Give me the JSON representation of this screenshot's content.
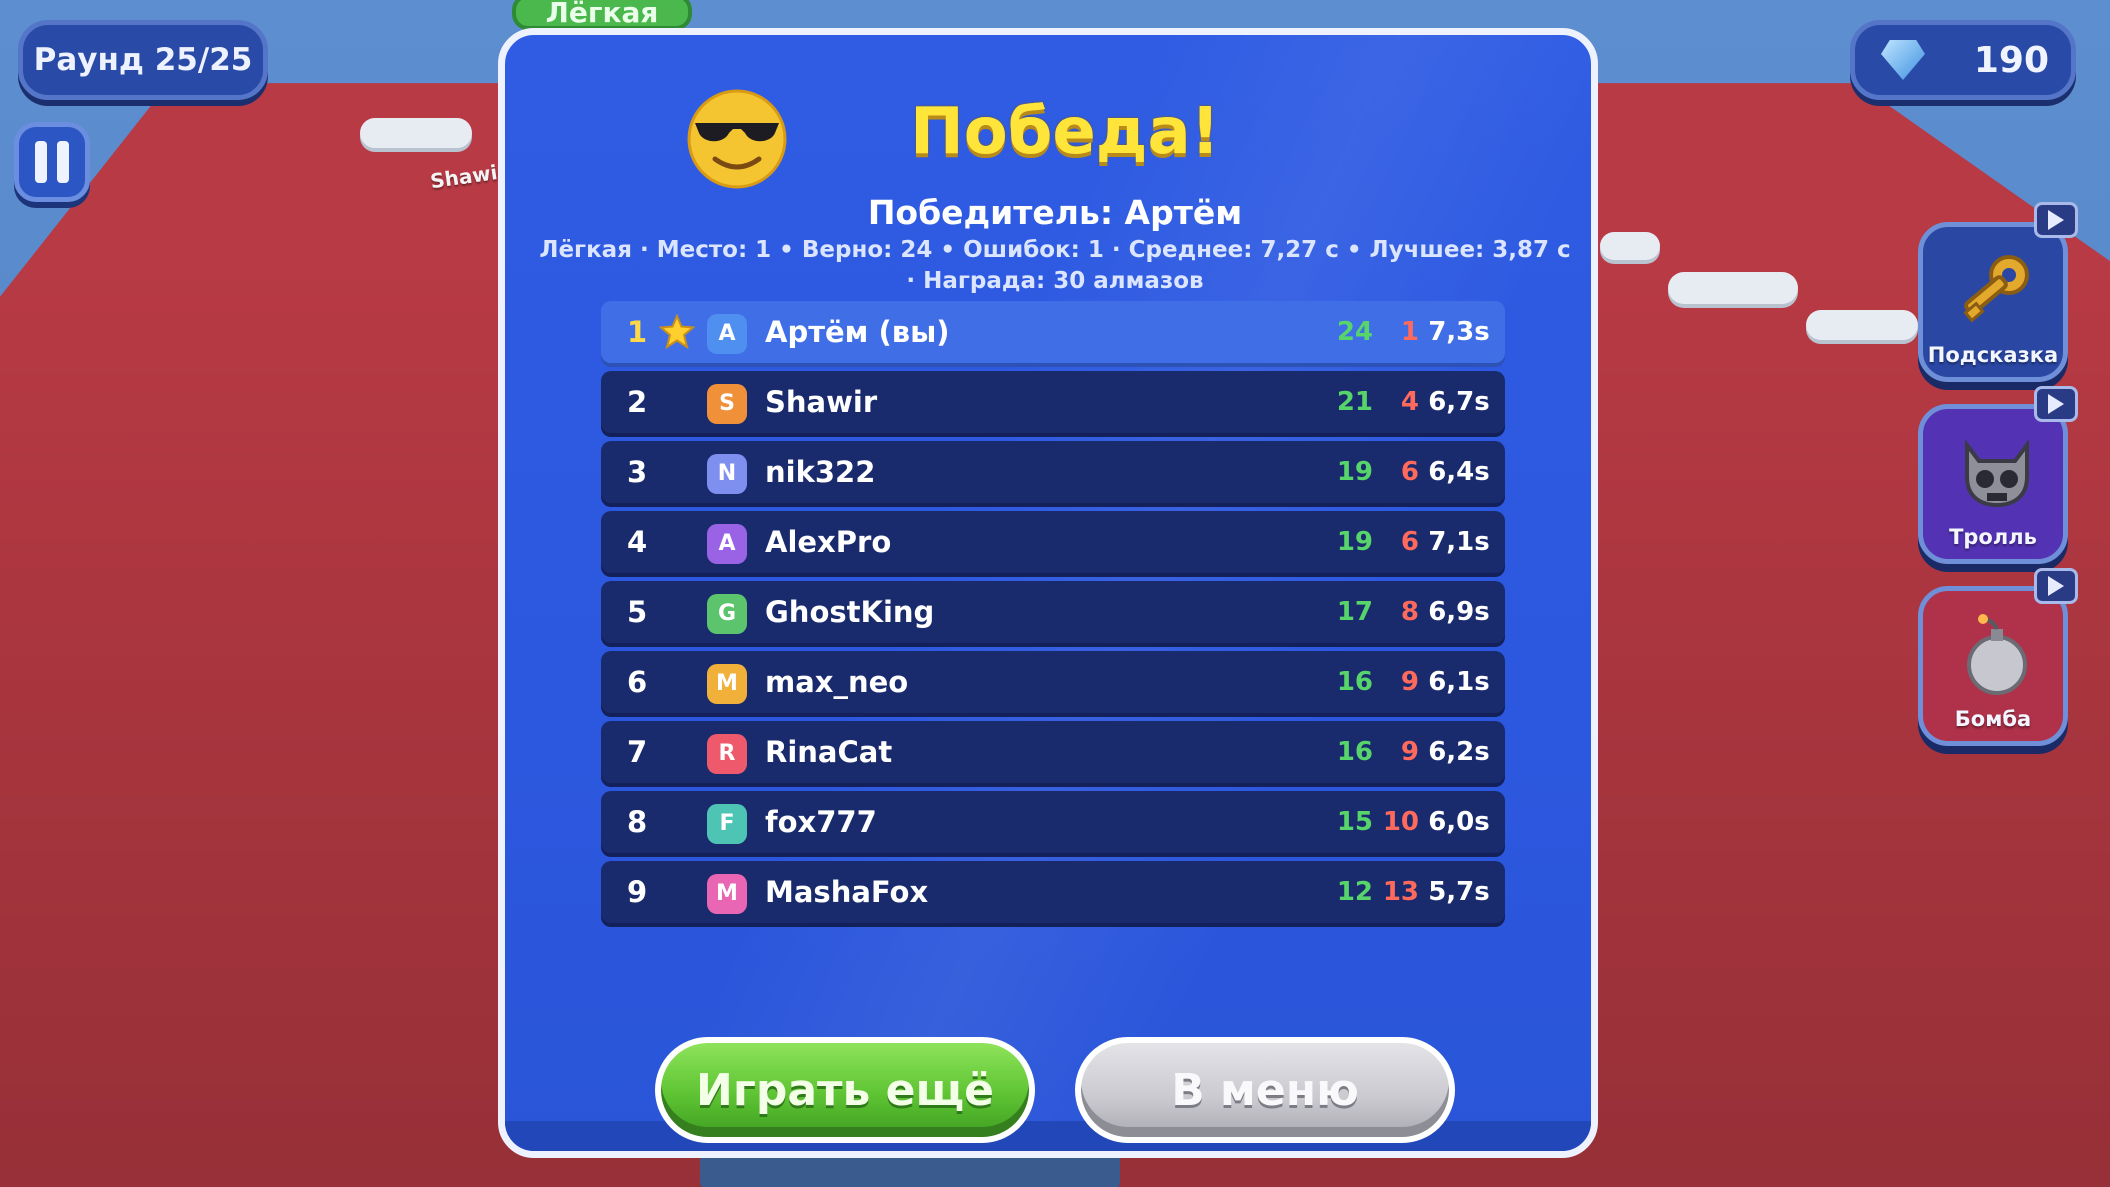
{
  "hud": {
    "round": "Раунд 25/25",
    "difficulty_tag": "Лёгкая",
    "gems": "190",
    "bg_player_name": "Shawir"
  },
  "powerups": [
    {
      "label": "Подсказка",
      "icon": "key-icon",
      "color": "#2a47a4"
    },
    {
      "label": "Тролль",
      "icon": "troll-skull-icon",
      "color": "#5432b4"
    },
    {
      "label": "Бомба",
      "icon": "bomb-icon",
      "color": "#b0314a"
    }
  ],
  "modal": {
    "title": "Победа!",
    "winner": "Победитель: Артём",
    "stats_line1": "Лёгкая · Место: 1 • Верно: 24 • Ошибок: 1 · Среднее: 7,27 с • Лучшее: 3,87 с",
    "stats_line2": "· Награда: 30 алмазов",
    "play_again": "Играть ещё",
    "menu": "В меню"
  },
  "leaderboard": [
    {
      "rank": "1",
      "avatar": "A",
      "name": "Артём (вы)",
      "correct": "24",
      "wrong": "1",
      "time": "7,3s",
      "avatar_color": "#4f8ff0",
      "me": true
    },
    {
      "rank": "2",
      "avatar": "S",
      "name": "Shawir",
      "correct": "21",
      "wrong": "4",
      "time": "6,7s",
      "avatar_color": "#f0913a"
    },
    {
      "rank": "3",
      "avatar": "N",
      "name": "nik322",
      "correct": "19",
      "wrong": "6",
      "time": "6,4s",
      "avatar_color": "#7f8ff0"
    },
    {
      "rank": "4",
      "avatar": "A",
      "name": "AlexPro",
      "correct": "19",
      "wrong": "6",
      "time": "7,1s",
      "avatar_color": "#9a63e6"
    },
    {
      "rank": "5",
      "avatar": "G",
      "name": "GhostKing",
      "correct": "17",
      "wrong": "8",
      "time": "6,9s",
      "avatar_color": "#5cc46c"
    },
    {
      "rank": "6",
      "avatar": "M",
      "name": "max_neo",
      "correct": "16",
      "wrong": "9",
      "time": "6,1s",
      "avatar_color": "#f0b03a"
    },
    {
      "rank": "7",
      "avatar": "R",
      "name": "RinaCat",
      "correct": "16",
      "wrong": "9",
      "time": "6,2s",
      "avatar_color": "#ee5a6c"
    },
    {
      "rank": "8",
      "avatar": "F",
      "name": "fox777",
      "correct": "15",
      "wrong": "10",
      "time": "6,0s",
      "avatar_color": "#4ec4b4"
    },
    {
      "rank": "9",
      "avatar": "M",
      "name": "MashaFox",
      "correct": "12",
      "wrong": "13",
      "time": "5,7s",
      "avatar_color": "#e866b4"
    }
  ]
}
